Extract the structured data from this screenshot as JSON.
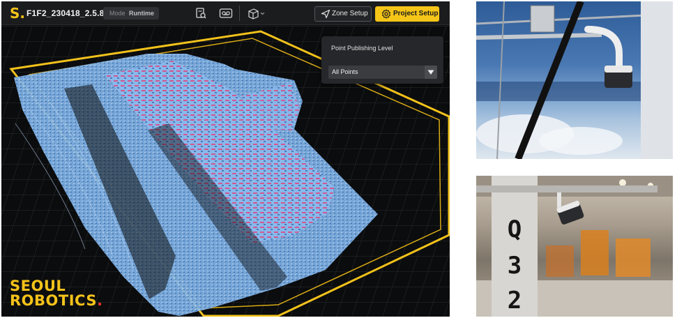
{
  "app": {
    "logo_letter": "S.",
    "project_name": "F1F2_230418_2.5.8",
    "mode_label": "Mode",
    "mode_value": "Runtime",
    "toolbar_icons": [
      "search-document-icon",
      "recorder-icon",
      "cube-view-icon",
      "chevron-down-icon"
    ],
    "zone_setup_label": "Zone Setup",
    "project_setup_label": "Project Setup",
    "accent_color": "#f5c518"
  },
  "point_publishing": {
    "title": "Point Publishing Level",
    "selected": "All Points"
  },
  "brand": {
    "line1": "SEOUL",
    "line2": "ROBOTICS",
    "dot": "."
  },
  "photos": {
    "sign_text": "Q32"
  }
}
